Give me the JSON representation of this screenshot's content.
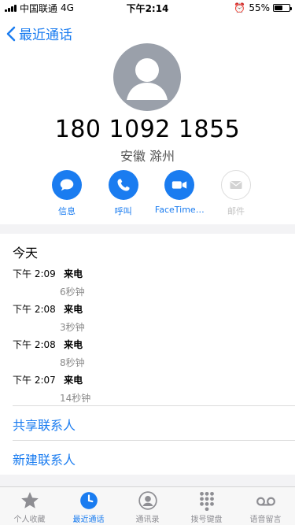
{
  "status_bar": {
    "carrier": "中国联通",
    "network": "4G",
    "time": "下午2:14",
    "battery_percent": "55%",
    "battery_level": 0.55
  },
  "nav": {
    "back_label": "最近通话"
  },
  "contact": {
    "number": "180 1092 1855",
    "location": "安徽 滁州"
  },
  "actions": [
    {
      "label": "信息",
      "icon": "message-icon",
      "enabled": true
    },
    {
      "label": "呼叫",
      "icon": "phone-icon",
      "enabled": true
    },
    {
      "label": "FaceTime…",
      "icon": "video-icon",
      "enabled": true
    },
    {
      "label": "邮件",
      "icon": "mail-icon",
      "enabled": false
    }
  ],
  "recent_calls": {
    "title": "今天",
    "calls": [
      {
        "time": "下午 2:09",
        "type": "来电",
        "duration": "6秒钟"
      },
      {
        "time": "下午 2:08",
        "type": "来电",
        "duration": "3秒钟"
      },
      {
        "time": "下午 2:08",
        "type": "来电",
        "duration": "8秒钟"
      },
      {
        "time": "下午 2:07",
        "type": "来电",
        "duration": "14秒钟"
      }
    ]
  },
  "links": {
    "share_contact": "共享联系人",
    "new_contact": "新建联系人"
  },
  "tab_bar": {
    "items": [
      {
        "label": "个人收藏",
        "icon": "star-icon",
        "active": false
      },
      {
        "label": "最近通话",
        "icon": "clock-icon",
        "active": true
      },
      {
        "label": "通讯录",
        "icon": "contacts-icon",
        "active": false
      },
      {
        "label": "拨号键盘",
        "icon": "keypad-icon",
        "active": false
      },
      {
        "label": "语音留言",
        "icon": "voicemail-icon",
        "active": false
      }
    ]
  },
  "colors": {
    "accent": "#1a7cf0",
    "avatar": "#9aa0aa",
    "inactive_tab": "#8e8e93"
  }
}
